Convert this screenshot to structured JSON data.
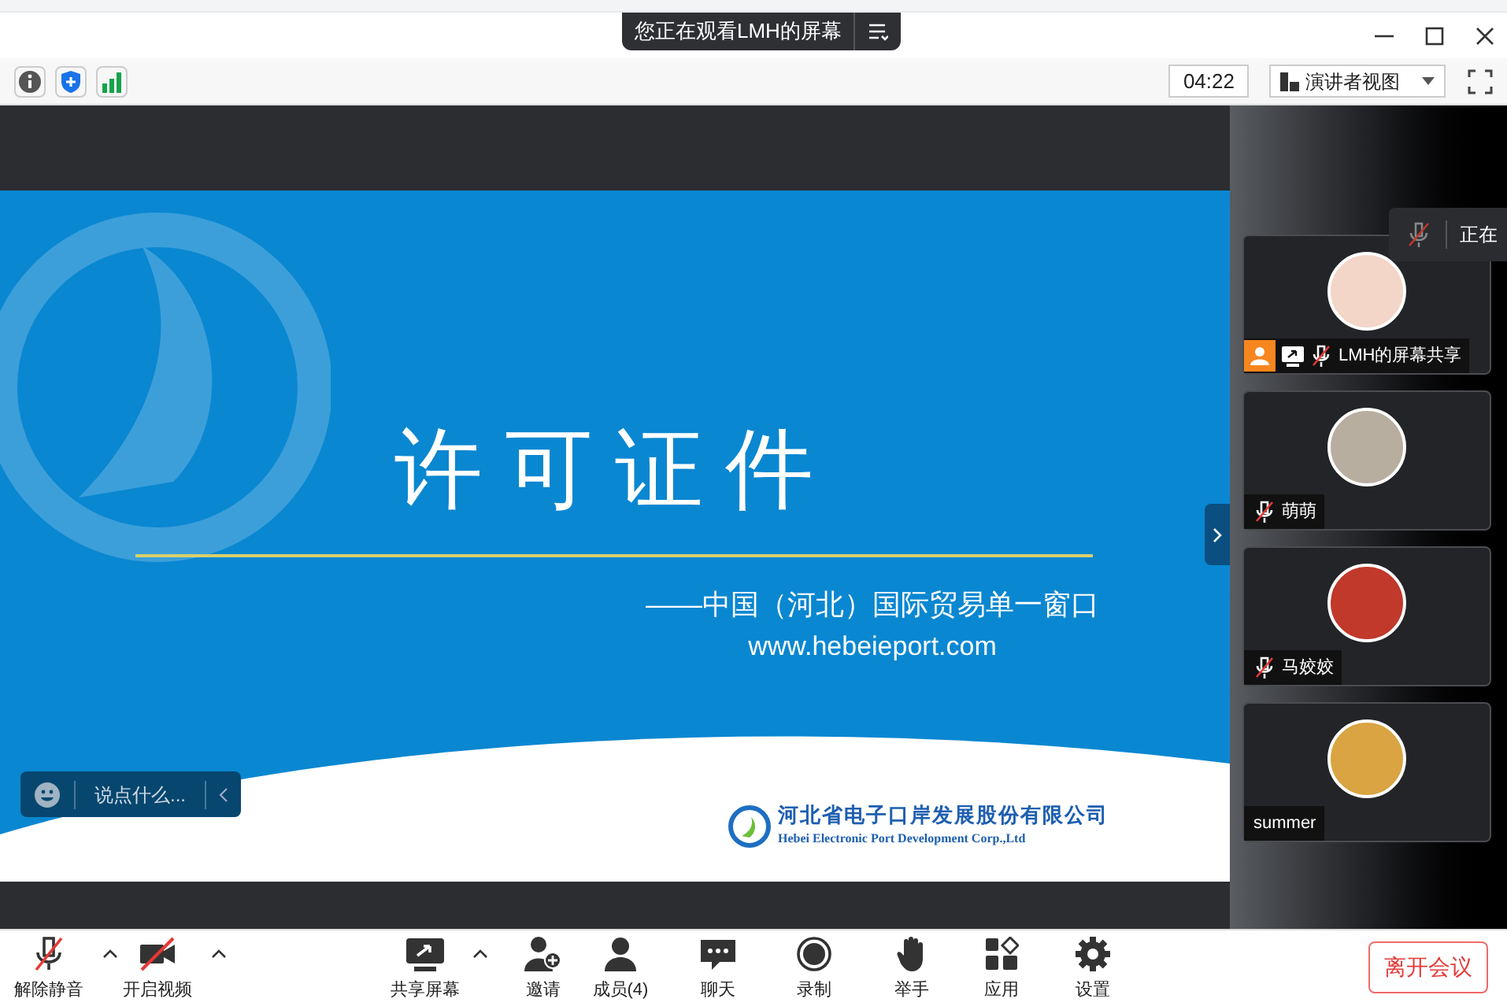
{
  "banner": {
    "text": "您正在观看LMH的屏幕"
  },
  "toolbar": {
    "timer": "04:22",
    "view_button": "演讲者视图"
  },
  "slide": {
    "title": "许可证件",
    "subtitle": "——中国（河北）国际贸易单一窗口",
    "url": "www.hebeieport.com",
    "company_cn": "河北省电子口岸发展股份有限公司",
    "company_en": "Hebei Electronic Port Development Corp.,Ltd"
  },
  "chat_box": {
    "placeholder": "说点什么..."
  },
  "speaking_popup": {
    "text": "正在"
  },
  "participants": [
    {
      "name": "LMH的屏幕共享",
      "host": true,
      "sharing": true,
      "muted": true
    },
    {
      "name": "萌萌",
      "host": false,
      "sharing": false,
      "muted": true
    },
    {
      "name": "马姣姣",
      "host": false,
      "sharing": false,
      "muted": true
    },
    {
      "name": "summer",
      "host": false,
      "sharing": false,
      "muted": false
    }
  ],
  "controls": [
    {
      "kind": "mic",
      "label": "解除静音",
      "muted": true,
      "caret": true
    },
    {
      "kind": "video",
      "label": "开启视频",
      "muted": true,
      "caret": true
    },
    {
      "kind": "share",
      "label": "共享屏幕",
      "caret": true
    },
    {
      "kind": "invite",
      "label": "邀请"
    },
    {
      "kind": "members",
      "label": "成员(4)"
    },
    {
      "kind": "chat",
      "label": "聊天"
    },
    {
      "kind": "record",
      "label": "录制"
    },
    {
      "kind": "hand",
      "label": "举手"
    },
    {
      "kind": "apps",
      "label": "应用"
    },
    {
      "kind": "settings",
      "label": "设置"
    }
  ],
  "leave_button": "离开会议"
}
